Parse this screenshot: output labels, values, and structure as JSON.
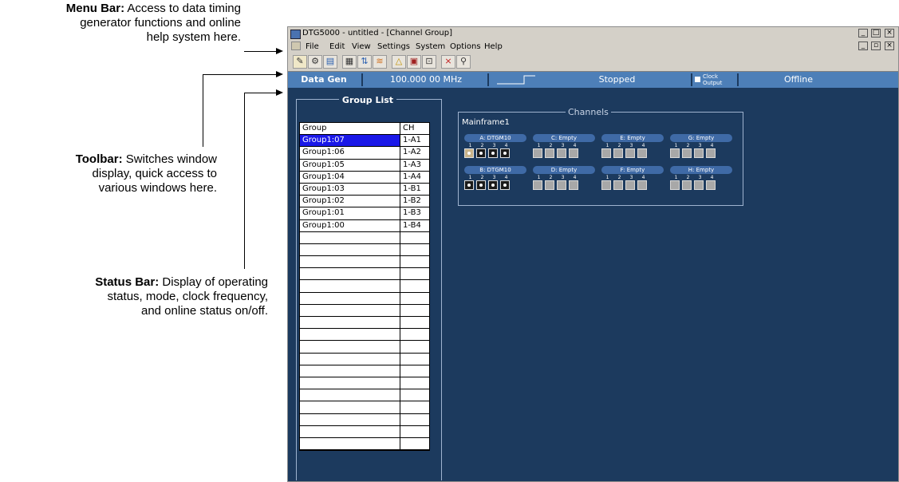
{
  "callouts": {
    "menu_bar": {
      "title": "Menu Bar:",
      "text1": "Access to data timing",
      "text2": "generator functions and online",
      "text3": "help system here."
    },
    "toolbar": {
      "title": "Toolbar:",
      "text1": "Switches window",
      "text2": "display, quick access to",
      "text3": "various windows here."
    },
    "status_bar": {
      "title": "Status Bar:",
      "text1": "Display of operating",
      "text2": "status, mode, clock frequency,",
      "text3": "and online status on/off."
    }
  },
  "window": {
    "title": "DTG5000 - untitled - [Channel Group]",
    "menu": [
      "File",
      "Edit",
      "View",
      "Settings",
      "System",
      "Options",
      "Help"
    ]
  },
  "status": {
    "mode": "Data Gen",
    "frequency": "100.000 00 MHz",
    "run_state": "Stopped",
    "clock_output": "Clock Output",
    "online": "Offline"
  },
  "group_list": {
    "title": "Group List",
    "headers": [
      "Group",
      "CH"
    ],
    "rows": [
      {
        "group": "Group1:07",
        "ch": "1-A1",
        "selected": true
      },
      {
        "group": "Group1:06",
        "ch": "1-A2"
      },
      {
        "group": "Group1:05",
        "ch": "1-A3"
      },
      {
        "group": "Group1:04",
        "ch": "1-A4"
      },
      {
        "group": "Group1:03",
        "ch": "1-B1"
      },
      {
        "group": "Group1:02",
        "ch": "1-B2"
      },
      {
        "group": "Group1:01",
        "ch": "1-B3"
      },
      {
        "group": "Group1:00",
        "ch": "1-B4"
      }
    ],
    "empty_rows": 18
  },
  "channels": {
    "title": "Channels",
    "mainframe": "Mainframe1",
    "slots": [
      {
        "label": "A: DTGM10",
        "nums": [
          "1",
          "2",
          "3",
          "4"
        ],
        "state": [
          "cur",
          "on",
          "on",
          "on"
        ]
      },
      {
        "label": "C: Empty",
        "nums": [
          "1",
          "2",
          "3",
          "4"
        ],
        "state": [
          "off",
          "off",
          "off",
          "off"
        ]
      },
      {
        "label": "E: Empty",
        "nums": [
          "1",
          "2",
          "3",
          "4"
        ],
        "state": [
          "off",
          "off",
          "off",
          "off"
        ]
      },
      {
        "label": "G: Empty",
        "nums": [
          "1",
          "2",
          "3",
          "4"
        ],
        "state": [
          "off",
          "off",
          "off",
          "off"
        ]
      },
      {
        "label": "B: DTGM10",
        "nums": [
          "1",
          "2",
          "3",
          "4"
        ],
        "state": [
          "on",
          "on",
          "on",
          "on"
        ]
      },
      {
        "label": "D: Empty",
        "nums": [
          "1",
          "2",
          "3",
          "4"
        ],
        "state": [
          "off",
          "off",
          "off",
          "off"
        ]
      },
      {
        "label": "F: Empty",
        "nums": [
          "1",
          "2",
          "3",
          "4"
        ],
        "state": [
          "off",
          "off",
          "off",
          "off"
        ]
      },
      {
        "label": "H: Empty",
        "nums": [
          "1",
          "2",
          "3",
          "4"
        ],
        "state": [
          "off",
          "off",
          "off",
          "off"
        ]
      }
    ]
  }
}
